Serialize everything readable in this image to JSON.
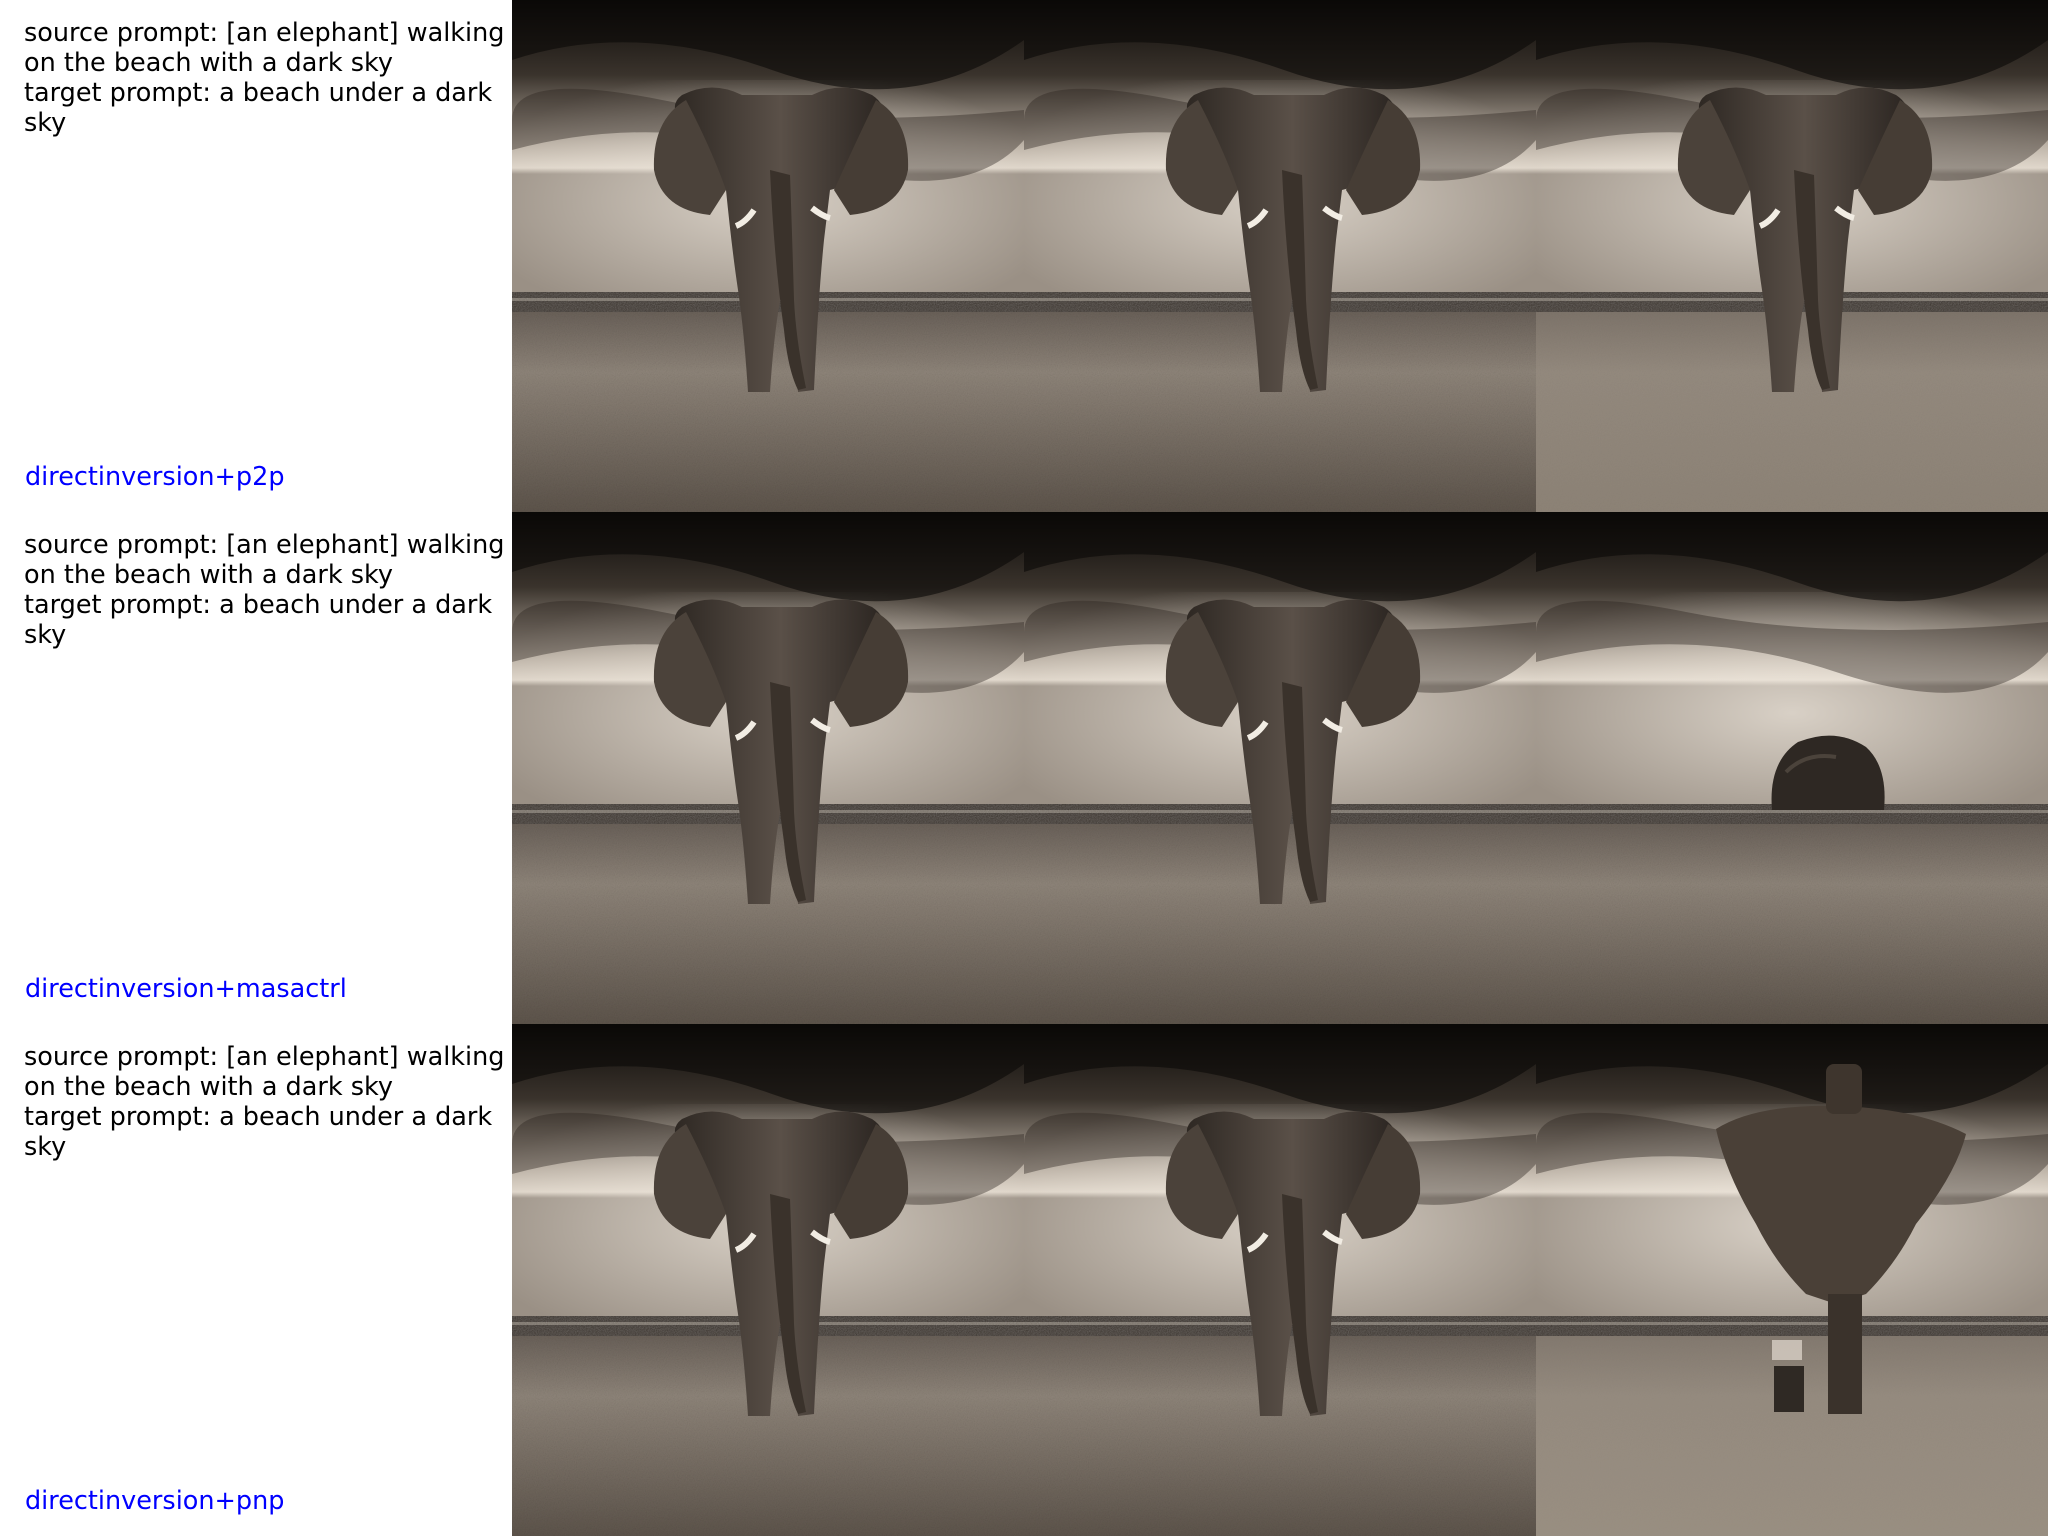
{
  "colors": {
    "prompt_text": "#000000",
    "method_label": "#0000ff",
    "background": "#ffffff"
  },
  "rows": [
    {
      "source_prompt": "source prompt: [an elephant] walking on the beach with a dark sky",
      "target_prompt": "target prompt: a beach under a dark sky",
      "method": "directinversion+p2p",
      "images": [
        "elephant-beach-source",
        "elephant-beach-reconstruction",
        "elephant-beach-edited"
      ]
    },
    {
      "source_prompt": "source prompt: [an elephant] walking on the beach with a dark sky",
      "target_prompt": "target prompt: a beach under a dark sky",
      "method": "directinversion+masactrl",
      "images": [
        "elephant-beach-source",
        "elephant-beach-reconstruction",
        "beach-with-rock-edited"
      ]
    },
    {
      "source_prompt": "source prompt: [an elephant] walking on the beach with a dark sky",
      "target_prompt": "target prompt: a beach under a dark sky",
      "method": "directinversion+pnp",
      "images": [
        "elephant-beach-source",
        "elephant-beach-reconstruction",
        "beach-with-statue-edited"
      ]
    }
  ]
}
